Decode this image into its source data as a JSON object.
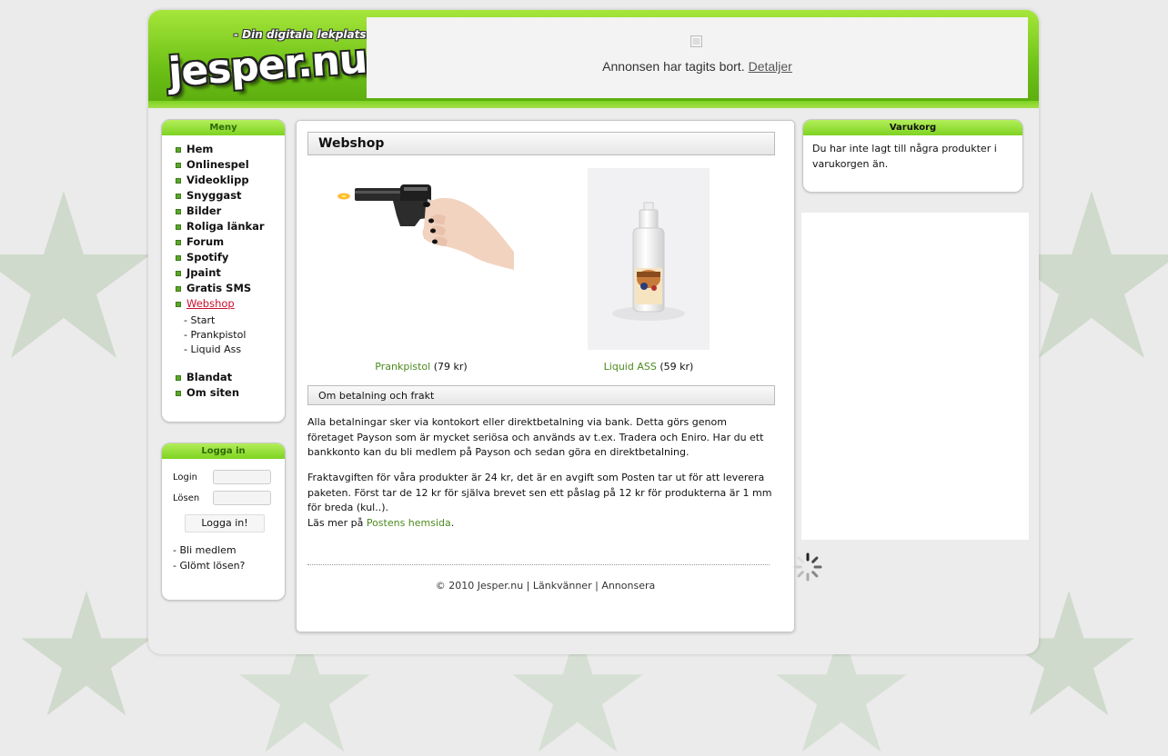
{
  "header": {
    "tagline": "- Din digitala lekplats!",
    "logo": "jesper.nu",
    "ad_removed_text": "Annonsen har tagits bort.",
    "ad_details_link": "Detaljer"
  },
  "menu": {
    "title": "Meny",
    "items": [
      {
        "label": "Hem"
      },
      {
        "label": "Onlinespel"
      },
      {
        "label": "Videoklipp"
      },
      {
        "label": "Snyggast"
      },
      {
        "label": "Bilder"
      },
      {
        "label": "Roliga länkar"
      },
      {
        "label": "Forum"
      },
      {
        "label": "Spotify"
      },
      {
        "label": "Jpaint"
      },
      {
        "label": "Gratis SMS"
      },
      {
        "label": "Webshop",
        "active": true
      }
    ],
    "sub_items": [
      {
        "label": "-  Start"
      },
      {
        "label": "-  Prankpistol"
      },
      {
        "label": "-  Liquid Ass"
      }
    ],
    "items_after": [
      {
        "label": "Blandat"
      },
      {
        "label": "Om siten"
      }
    ]
  },
  "login": {
    "title": "Logga in",
    "login_label": "Login",
    "password_label": "Lösen",
    "button": "Logga in!",
    "register_link": "- Bli medlem",
    "forgot_link": "- Glömt lösen?"
  },
  "content": {
    "title": "Webshop",
    "products": [
      {
        "name": "Prankpistol",
        "price": "(79 kr)"
      },
      {
        "name": "Liquid ASS",
        "price": "(59 kr)"
      }
    ],
    "payment_heading": "Om betalning och frakt",
    "para1": "Alla betalningar sker via kontokort eller direktbetalning via bank. Detta görs genom företaget Payson som är mycket seriösa och används av t.ex. Tradera och Eniro. Har du ett bankkonto kan du bli medlem på Payson och sedan göra en direktbetalning.",
    "para2_start": "Fraktavgiften för våra produkter är 24 kr, det är en avgift som Posten tar ut för att leverera paketen. Först tar de 12 kr för själva brevet sen ett påslag på 12 kr för produkterna är 1 mm för breda (kul..).",
    "para2_more": "Läs mer på",
    "para2_link": "Postens hemsida",
    "para2_end": ".",
    "footer": {
      "copyright": "© 2010 Jesper.nu",
      "sep": "|",
      "link1": "Länkvänner",
      "link2": "Annonsera"
    }
  },
  "cart": {
    "title": "Varukorg",
    "empty_text": "Du har inte lagt till några produkter i varukorgen än."
  },
  "colors": {
    "brand_green": "#7ed321",
    "link_green": "#4b8a1d",
    "active_red": "#c8102e"
  }
}
